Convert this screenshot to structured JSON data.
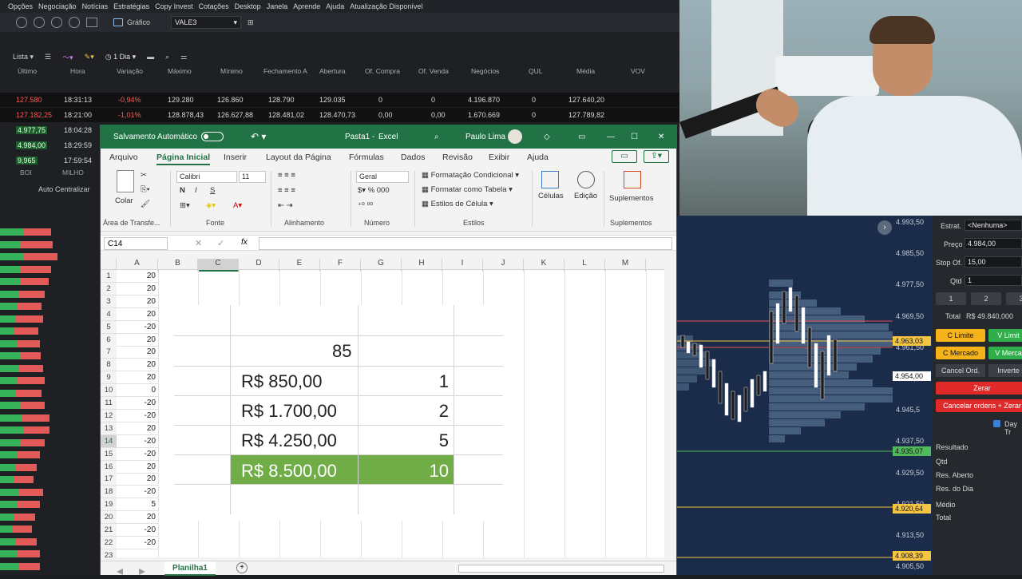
{
  "platform": {
    "menu": [
      "Opções",
      "Negociação",
      "Notícias",
      "Estratégias",
      "Copy Invest",
      "Cotações",
      "Desktop",
      "Janela",
      "Aprende",
      "Ajuda",
      "Atualização Disponível"
    ],
    "grafico_label": "Gráfico",
    "ticker": "VALE3",
    "toolbar2": {
      "list": "Lista",
      "period": "1 Dia"
    },
    "columns": [
      "Último",
      "Hora",
      "Variação",
      "Máximo",
      "Mínimo",
      "Fechamento A",
      "Abertura",
      "Of. Compra",
      "Of. Venda",
      "Negócios",
      "QUL",
      "Média",
      "VOV"
    ],
    "quotes": [
      {
        "last": "127.580",
        "time": "18:31:13",
        "change": "-0,94%",
        "max": "129.280",
        "min": "126.860",
        "close": "128.790",
        "open": "129.035",
        "bid": "0",
        "ask": "0",
        "trades": "4.196.870",
        "qul": "0",
        "avg": "127.640,20"
      },
      {
        "last": "127.182,25",
        "time": "18:21:00",
        "change": "-1,01%",
        "max": "128.878,43",
        "min": "126.627,88",
        "close": "128.481,02",
        "open": "128.470,73",
        "bid": "0,00",
        "ask": "0,00",
        "trades": "1.670.669",
        "qul": "0",
        "avg": "127.789,82"
      },
      {
        "last": "4.977,75",
        "time": "18:04:28"
      },
      {
        "last": "4.984,00",
        "time": "18:29:59"
      },
      {
        "last": "9,965",
        "time": "17:59:54"
      }
    ],
    "side_headers": [
      "BOI",
      "MILHO"
    ],
    "auto_center": "Auto Centralizar"
  },
  "excel": {
    "autosave": "Salvamento Automático",
    "filename": "Pasta1",
    "app": "Excel",
    "user": "Paulo Lima",
    "tabs": [
      "Arquivo",
      "Página Inicial",
      "Inserir",
      "Layout da Página",
      "Fórmulas",
      "Dados",
      "Revisão",
      "Exibir",
      "Ajuda"
    ],
    "ribbon": {
      "paste": "Colar",
      "clipboard": "Área de Transfe...",
      "font_name": "Calibri",
      "font_size": "11",
      "font_group": "Fonte",
      "align_group": "Alinhamento",
      "number_format": "Geral",
      "number_group": "Número",
      "cond_format": "Formatação Condicional",
      "format_table": "Formatar como Tabela",
      "cell_styles": "Estilos de Célula",
      "styles_group": "Estilos",
      "cells": "Células",
      "editing": "Edição",
      "addins": "Suplementos",
      "addins_group": "Suplementos"
    },
    "namebox": "C14",
    "fx": "fx",
    "columns": [
      "A",
      "B",
      "C",
      "D",
      "E",
      "F",
      "G",
      "H",
      "I",
      "J",
      "K",
      "L",
      "M"
    ],
    "rows": [
      {
        "n": "1",
        "a": "20"
      },
      {
        "n": "2",
        "a": "20"
      },
      {
        "n": "3",
        "a": "20"
      },
      {
        "n": "4",
        "a": "20"
      },
      {
        "n": "5",
        "a": "-20"
      },
      {
        "n": "6",
        "a": "20"
      },
      {
        "n": "7",
        "a": "20"
      },
      {
        "n": "8",
        "a": "20"
      },
      {
        "n": "9",
        "a": "20"
      },
      {
        "n": "10",
        "a": "0"
      },
      {
        "n": "11",
        "a": "-20"
      },
      {
        "n": "12",
        "a": "-20"
      },
      {
        "n": "13",
        "a": "20"
      },
      {
        "n": "14",
        "a": "-20"
      },
      {
        "n": "15",
        "a": "-20"
      },
      {
        "n": "16",
        "a": "20"
      },
      {
        "n": "17",
        "a": "20"
      },
      {
        "n": "18",
        "a": "-20"
      },
      {
        "n": "19",
        "a": "5"
      },
      {
        "n": "20",
        "a": "20"
      },
      {
        "n": "21",
        "a": "-20"
      },
      {
        "n": "22",
        "a": "-20"
      },
      {
        "n": "23",
        "a": ""
      }
    ],
    "table": {
      "header_value": "85",
      "rows": [
        {
          "value": "R$     850,00",
          "qty": "1"
        },
        {
          "value": "R$ 1.700,00",
          "qty": "2"
        },
        {
          "value": "R$ 4.250,00",
          "qty": "5"
        },
        {
          "value": "R$ 8.500,00",
          "qty": "10"
        }
      ]
    },
    "sheet_tab": "Planilha1"
  },
  "chart": {
    "prices": [
      "4.993,50",
      "4.985,50",
      "4.977,50",
      "4.969,50",
      "4.961,50",
      "4.953,50",
      "4.945,5",
      "4.937,50",
      "4.929,50",
      "4.921,50",
      "4.913,50",
      "4.905,50"
    ],
    "tags": [
      {
        "value": "4.963,03",
        "color": "#f5c542"
      },
      {
        "value": "4.954,00",
        "color": "#ffffff"
      },
      {
        "value": "4.935,07",
        "color": "#52b95a"
      },
      {
        "value": "4.920,64",
        "color": "#f5c542"
      },
      {
        "value": "4.908,39",
        "color": "#f5c542"
      }
    ]
  },
  "order": {
    "strategy_label": "Estrat.",
    "strategy_value": "<Nenhuma>",
    "price_label": "Preço",
    "price_value": "4.984,00",
    "stop_label": "Stop Of.",
    "stop_value": "15,00",
    "qty_label": "Qtd",
    "qty_value": "1",
    "quick": [
      "1",
      "2",
      "3"
    ],
    "total_label": "Total",
    "total_value": "R$ 49.840,000",
    "c_limite": "C Limite",
    "v_limite": "V Limit",
    "c_mercado": "C Mercado",
    "v_mercado": "V Merca",
    "cancel": "Cancel Ord.",
    "invert": "Inverte",
    "zerar": "Zerar",
    "cancel_all": "Cancelar ordens + Zerar",
    "daytrade": "Day Tr",
    "result": "Resultado",
    "r_qtd": "Qtd",
    "r_open": "Res. Aberto",
    "r_day": "Res. do Dia",
    "r_avg": "Médio",
    "r_total": "Total"
  }
}
